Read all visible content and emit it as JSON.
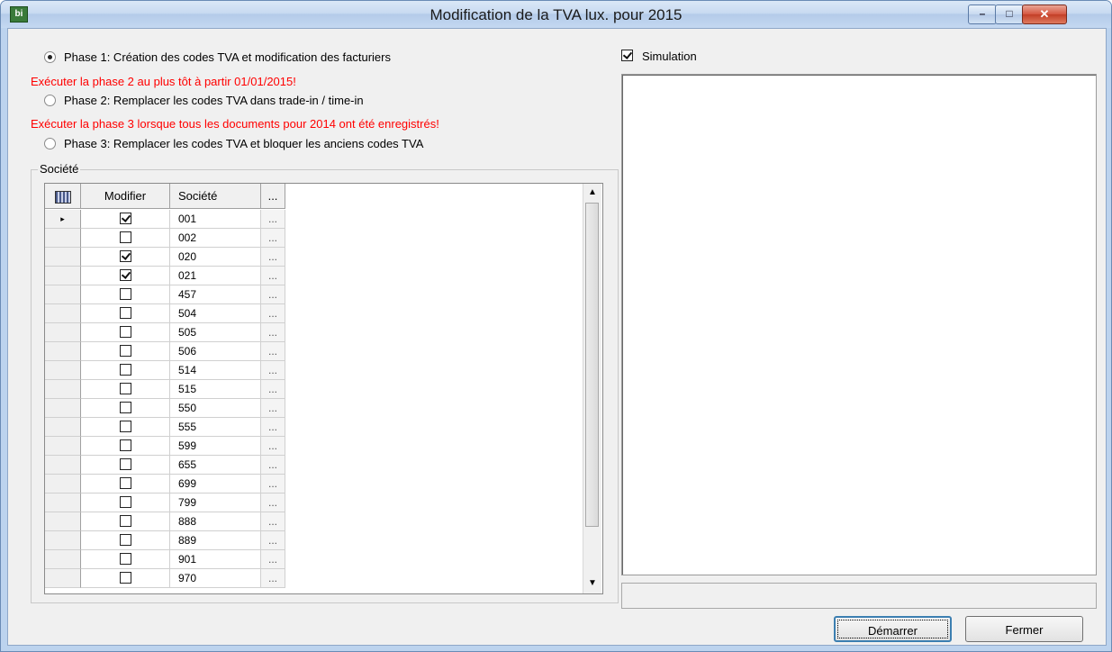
{
  "window": {
    "title": "Modification de la TVA lux. pour 2015",
    "icon": "bi-app-icon"
  },
  "phases": {
    "phase1": {
      "label": "Phase 1: Création des codes TVA et modification des facturiers",
      "selected": true
    },
    "warning2": "Exécuter la phase 2 au plus tôt à partir 01/01/2015!",
    "phase2": {
      "label": "Phase 2: Remplacer les codes TVA dans trade-in / time-in",
      "selected": false
    },
    "warning3": "Exécuter la phase 3 lorsque tous les documents pour 2014 ont été enregistrés!",
    "phase3": {
      "label": "Phase 3: Remplacer les codes TVA et bloquer les anciens codes TVA",
      "selected": false
    }
  },
  "societe_group": {
    "label": "Société"
  },
  "grid": {
    "columns": [
      "Modifier",
      "Société",
      "..."
    ],
    "rows": [
      {
        "code": "001",
        "checked": true
      },
      {
        "code": "002",
        "checked": false
      },
      {
        "code": "020",
        "checked": true
      },
      {
        "code": "021",
        "checked": true
      },
      {
        "code": "457",
        "checked": false
      },
      {
        "code": "504",
        "checked": false
      },
      {
        "code": "505",
        "checked": false
      },
      {
        "code": "506",
        "checked": false
      },
      {
        "code": "514",
        "checked": false
      },
      {
        "code": "515",
        "checked": false
      },
      {
        "code": "550",
        "checked": false
      },
      {
        "code": "555",
        "checked": false
      },
      {
        "code": "599",
        "checked": false
      },
      {
        "code": "655",
        "checked": false
      },
      {
        "code": "699",
        "checked": false
      },
      {
        "code": "799",
        "checked": false
      },
      {
        "code": "888",
        "checked": false
      },
      {
        "code": "889",
        "checked": false
      },
      {
        "code": "901",
        "checked": false
      },
      {
        "code": "970",
        "checked": false
      }
    ],
    "current_row_marker": "▸"
  },
  "simulation": {
    "label": "Simulation",
    "checked": true
  },
  "buttons": {
    "start": "Démarrer",
    "close": "Fermer"
  }
}
